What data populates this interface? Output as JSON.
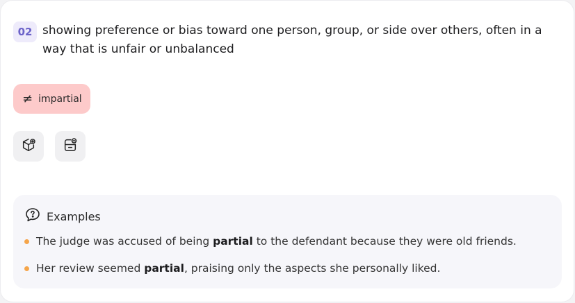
{
  "sense": {
    "number": "02",
    "definition": "showing preference or bias toward one person, group, or side over others, often in a way that is unfair or unbalanced"
  },
  "antonym": {
    "symbol": "≠",
    "word": "impartial",
    "color": "#fdcaca"
  },
  "actions": [
    {
      "icon": "cube-add-icon"
    },
    {
      "icon": "storage-remove-icon"
    }
  ],
  "examples": {
    "title": "Examples",
    "icon": "question-bubble-icon",
    "bullet_color": "#f5a54a",
    "items": [
      {
        "before": "The judge was accused of being ",
        "term": "partial",
        "after": " to the defendant because they were old friends."
      },
      {
        "before": "Her review seemed ",
        "term": "partial",
        "after": ", praising only the aspects she personally liked."
      }
    ]
  }
}
